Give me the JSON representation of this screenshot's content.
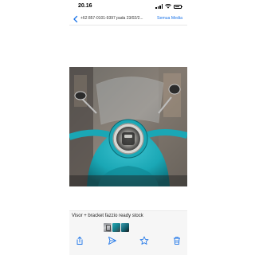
{
  "status_bar": {
    "time": "20.16"
  },
  "nav": {
    "title": "+62 857-0101-9397 pada 23/02/2...",
    "action_label": "Semua Media"
  },
  "caption": "Visor + bracket fazzio ready stock",
  "icons": {
    "back": "chevron-left-icon",
    "share": "share-icon",
    "forward": "forward-icon",
    "star": "star-icon",
    "delete": "trash-icon"
  },
  "colors": {
    "accent": "#1a73e8",
    "scooter": "#1aa7b5"
  }
}
